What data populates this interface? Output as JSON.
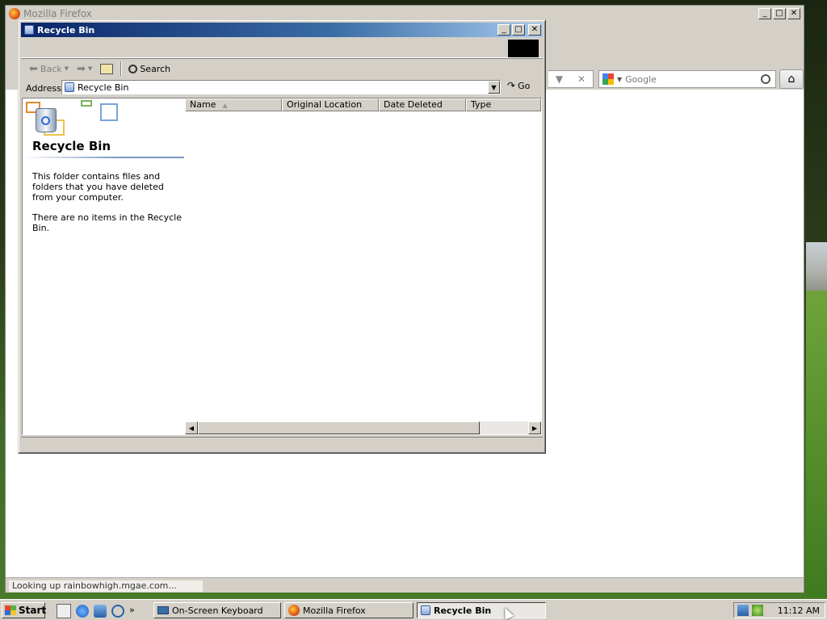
{
  "firefox": {
    "title": "Mozilla Firefox",
    "search_placeholder": "Google",
    "status_text": "Looking up rainbowhigh.mgae.com..."
  },
  "recycle_bin_window": {
    "title": "Recycle Bin",
    "toolbar": {
      "back": "Back",
      "search": "Search"
    },
    "address": {
      "label": "Address",
      "value": "Recycle Bin",
      "go": "Go"
    },
    "pane": {
      "title": "Recycle Bin",
      "description": "This folder contains files and folders that you have deleted from your computer.",
      "empty_message": "There are no items in the Recycle Bin."
    },
    "columns": [
      "Name",
      "Original Location",
      "Date Deleted",
      "Type"
    ]
  },
  "taskbar": {
    "start": "Start",
    "tasks": [
      "On-Screen Keyboard",
      "Mozilla Firefox",
      "Recycle Bin"
    ],
    "active_task": "Recycle Bin",
    "clock": "11:12 AM"
  },
  "colors": {
    "titlebar_active_start": "#0a246a",
    "titlebar_active_end": "#a6caf0",
    "window_face": "#d4d0c8"
  }
}
